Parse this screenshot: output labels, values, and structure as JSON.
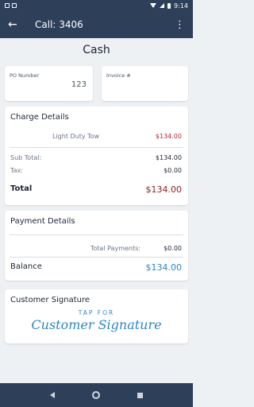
{
  "status_bar": {
    "time": "9:14"
  },
  "app_bar": {
    "title": "Call: 3406"
  },
  "page": {
    "title": "Cash"
  },
  "po_field": {
    "label": "PO Number",
    "value": "123"
  },
  "invoice_field": {
    "label": "Invoice #",
    "value": ""
  },
  "charge_details": {
    "title": "Charge Details",
    "items": [
      {
        "label": "Light Duty Tow",
        "amount": "$134.00"
      }
    ],
    "subtotal_label": "Sub Total:",
    "subtotal_value": "$134.00",
    "tax_label": "Tax:",
    "tax_value": "$0.00",
    "total_label": "Total",
    "total_value": "$134.00"
  },
  "payment_details": {
    "title": "Payment Details",
    "total_payments_label": "Total Payments:",
    "total_payments_value": "$0.00",
    "balance_label": "Balance",
    "balance_value": "$134.00"
  },
  "signature": {
    "title": "Customer Signature",
    "tap_small": "TAP FOR",
    "tap_big": "Customer Signature"
  },
  "colors": {
    "header": "#2e3f5a",
    "line_amount": "#b22631",
    "total": "#8c1f27",
    "balance": "#2f86c4",
    "signature": "#2f86c4"
  }
}
